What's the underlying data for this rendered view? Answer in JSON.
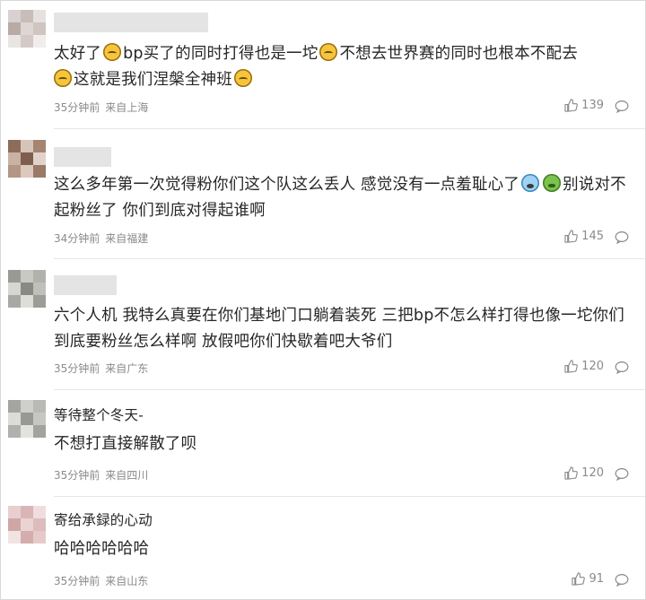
{
  "colors": {
    "text": "#262626",
    "meta": "#8a8a8a",
    "divider": "#e6e6e6"
  },
  "comments": [
    {
      "segments": [
        "太好了",
        "bp买了的同时打得也是一坨",
        "不想去世界赛的同时也根本不配去",
        "这就是我们涅槃全神班"
      ],
      "emojis": [
        "sleeping-face-icon",
        "sleeping-face-icon",
        "sleeping-face-icon",
        "sleeping-face-icon"
      ],
      "time": "35分钟前",
      "location": "来自上海",
      "likes": "139"
    },
    {
      "segments": [
        "这么多年第一次觉得粉你们这个队这么丢人 感觉没有一点羞耻心了",
        "别说对不起粉丝了 你们到底对得起谁啊"
      ],
      "emojis": [
        "cold-sweat-face-icon",
        "nauseated-face-icon"
      ],
      "time": "34分钟前",
      "location": "来自福建",
      "likes": "145"
    },
    {
      "segments": [
        "六个人机 我特么真要在你们基地门口躺着装死 三把bp不怎么样打得也像一坨你们到底要粉丝怎么样啊 放假吧你们快歇着吧大爷们"
      ],
      "time": "35分钟前",
      "location": "来自广东",
      "likes": "120"
    },
    {
      "lines": [
        "等待整个冬天-",
        "不想打直接解散了呗"
      ],
      "time": "35分钟前",
      "location": "来自四川",
      "likes": "120"
    },
    {
      "lines": [
        "寄给承録的心动",
        "哈哈哈哈哈哈"
      ],
      "time": "35分钟前",
      "location": "来自山东",
      "likes": "91"
    }
  ]
}
